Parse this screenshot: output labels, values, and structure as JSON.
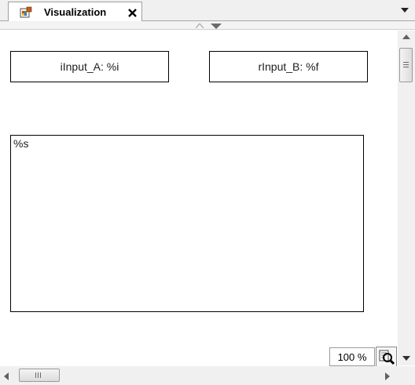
{
  "tab": {
    "title": "Visualization",
    "icon": "visualization-icon",
    "close_icon": "close-icon"
  },
  "visualization": {
    "elements": [
      {
        "label": "iInput_A: %i"
      },
      {
        "label": "rInput_B: %f"
      },
      {
        "label": "%s"
      }
    ]
  },
  "zoom": {
    "level": "100 %",
    "icon": "zoom-magnifier-icon"
  },
  "colors": {
    "tab_background": "#ffffff",
    "chrome_background": "#f0f0f0",
    "element_border": "#000000"
  }
}
